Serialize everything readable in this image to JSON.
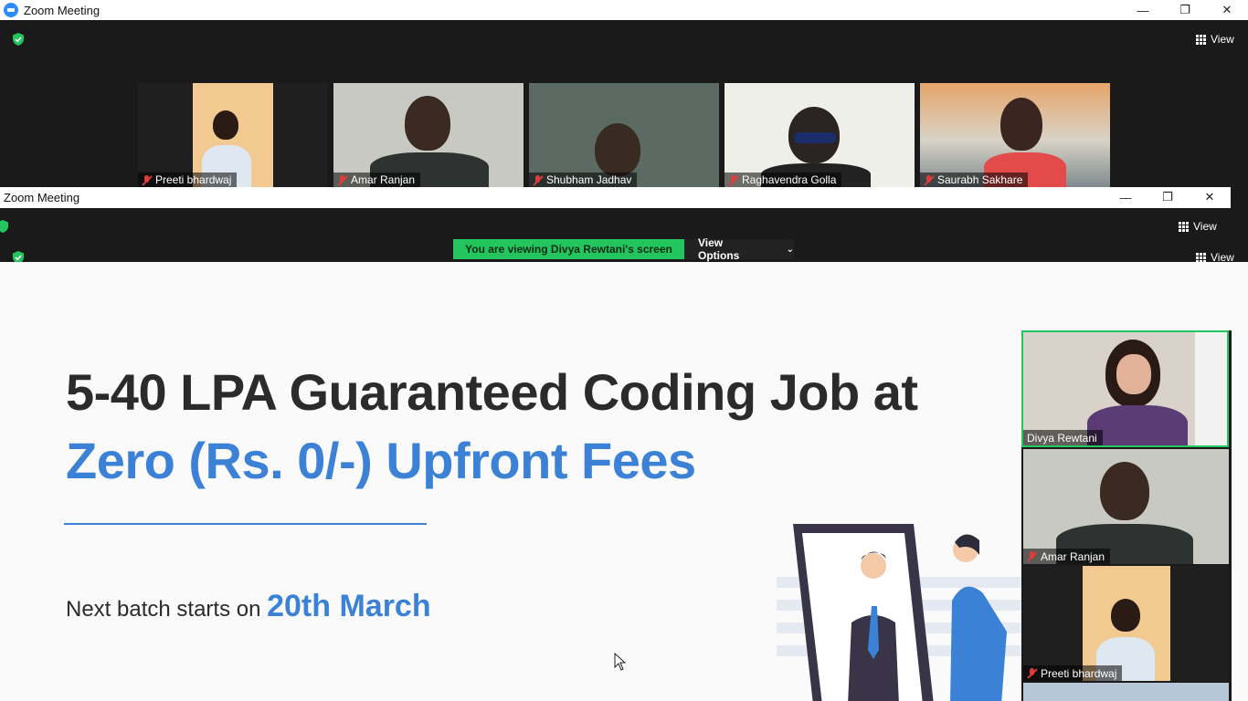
{
  "window": {
    "title": "Zoom Meeting",
    "minimize": "—",
    "restore": "❐",
    "close": "✕"
  },
  "top_meeting": {
    "view_label": "View",
    "participants": [
      {
        "name": "Preeti bhardwaj"
      },
      {
        "name": "Amar Ranjan"
      },
      {
        "name": "Shubham Jadhav"
      },
      {
        "name": "Raghavendra Golla"
      },
      {
        "name": "Saurabh Sakhare"
      }
    ]
  },
  "second_window": {
    "title": "Zoom Meeting",
    "view_label": "View"
  },
  "share_bar": {
    "viewing_text": "You are viewing Divya Rewtani's screen",
    "view_options_label": "View Options",
    "view_label": "View"
  },
  "slide": {
    "headline_line1": "5-40 LPA Guaranteed Coding Job at",
    "headline_line2": "Zero (Rs. 0/-) Upfront Fees",
    "next_prefix": "Next batch starts on ",
    "next_date": "20th March"
  },
  "sidebar": {
    "participants": [
      {
        "name": "Divya Rewtani"
      },
      {
        "name": "Amar Ranjan"
      },
      {
        "name": "Preeti bhardwaj"
      }
    ]
  },
  "colors": {
    "accent_blue": "#3b82d6",
    "share_green": "#22c55e",
    "muted_red": "#e03b3b"
  }
}
